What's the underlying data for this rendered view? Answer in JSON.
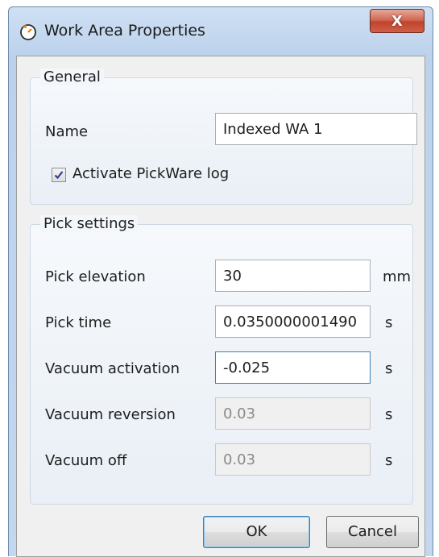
{
  "dialog": {
    "title": "Work Area Properties",
    "close_label": "X"
  },
  "general": {
    "legend": "General",
    "name_label": "Name",
    "name_value": "Indexed WA 1",
    "log_label": "Activate PickWare log",
    "log_checked": true
  },
  "pick_settings": {
    "legend": "Pick settings",
    "rows": [
      {
        "label": "Pick elevation",
        "value": "30",
        "unit": "mm",
        "enabled": true,
        "focused": false
      },
      {
        "label": "Pick time",
        "value": "0.0350000001490",
        "unit": "s",
        "enabled": true,
        "focused": false
      },
      {
        "label": "Vacuum activation",
        "value": "-0.025",
        "unit": "s",
        "enabled": true,
        "focused": true
      },
      {
        "label": "Vacuum reversion",
        "value": "0.03",
        "unit": "s",
        "enabled": false,
        "focused": false
      },
      {
        "label": "Vacuum off",
        "value": "0.03",
        "unit": "s",
        "enabled": false,
        "focused": false
      }
    ]
  },
  "buttons": {
    "ok": "OK",
    "cancel": "Cancel"
  }
}
